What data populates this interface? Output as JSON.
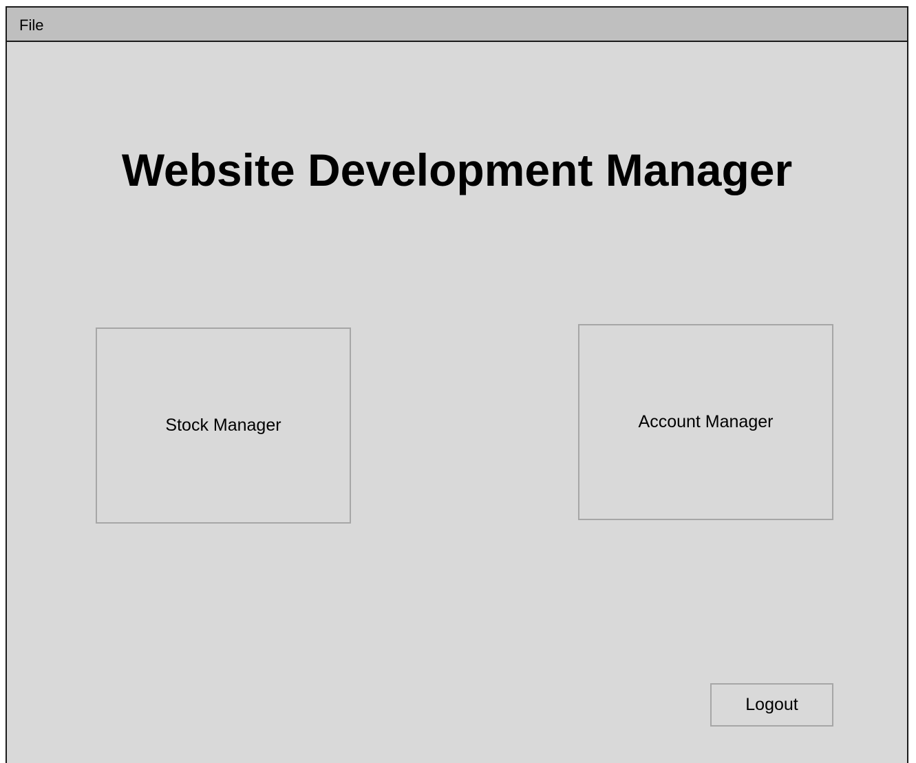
{
  "menubar": {
    "items": [
      {
        "label": "File"
      }
    ]
  },
  "main": {
    "title": "Website Development Manager",
    "tiles": [
      {
        "label": "Stock Manager"
      },
      {
        "label": "Account Manager"
      }
    ],
    "logout_label": "Logout"
  },
  "colors": {
    "window_background": "#d9d9d9",
    "menubar_background": "#bfbfbf",
    "button_border": "#a6a6a6",
    "window_border": "#1a1a1a"
  }
}
